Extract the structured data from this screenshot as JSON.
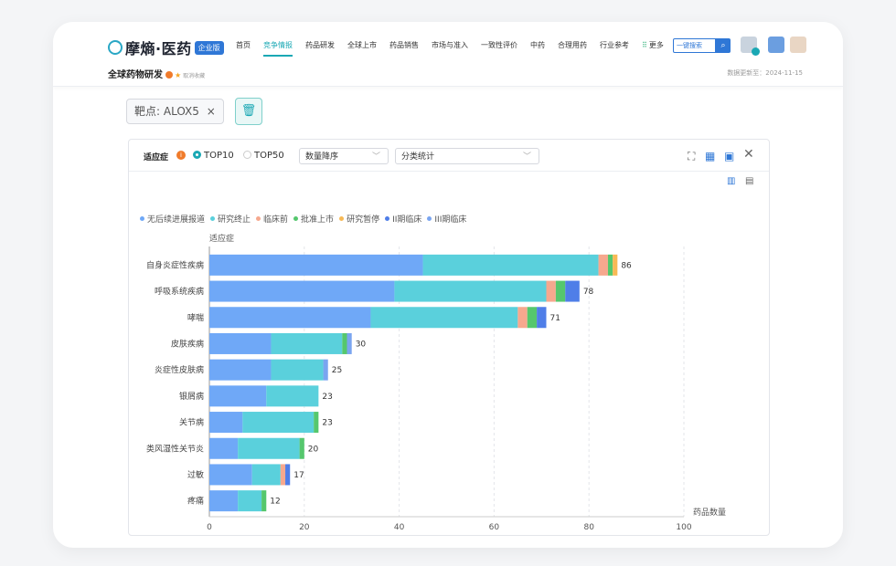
{
  "header": {
    "logo_text": "摩熵·医药",
    "logo_badge": "企业版",
    "nav": [
      "首页",
      "竞争情报",
      "药品研发",
      "全球上市",
      "药品销售",
      "市场与准入",
      "一致性评价",
      "中药",
      "合理用药",
      "行业参考",
      "更多"
    ],
    "nav_active_index": 1,
    "search_label": "一键搜索",
    "page_title": "全球药物研发",
    "favorite_label": "取消收藏",
    "update_text": "数据更新至：2024-11-15"
  },
  "filter": {
    "target_tag": "靶点: ALOX5",
    "tag_close": "×"
  },
  "panel": {
    "title": "适应症",
    "radio_top10": "TOP10",
    "radio_top50": "TOP50",
    "sort_select": "数量降序",
    "stat_select": "分类统计"
  },
  "colors": {
    "accent": "#1aa8b4",
    "primary": "#2f77d6"
  },
  "chart_data": {
    "type": "bar",
    "orientation": "horizontal",
    "stacked": true,
    "ylabel": "适应症",
    "xlabel": "药品数量",
    "xlim": [
      0,
      100
    ],
    "xticks": [
      0,
      20,
      40,
      60,
      80,
      100
    ],
    "categories": [
      "自身炎症性疾病",
      "呼吸系统疾病",
      "哮喘",
      "皮肤疾病",
      "炎症性皮肤病",
      "银屑病",
      "关节病",
      "类风湿性关节炎",
      "过敏",
      "疼痛"
    ],
    "totals": [
      86,
      78,
      71,
      30,
      25,
      23,
      23,
      20,
      17,
      12
    ],
    "series": [
      {
        "name": "无后续进展报道",
        "color": "#6fa8f7",
        "values": [
          45,
          39,
          34,
          13,
          13,
          12,
          7,
          6,
          9,
          6
        ]
      },
      {
        "name": "研究终止",
        "color": "#5ad0dc",
        "values": [
          37,
          32,
          31,
          15,
          11,
          11,
          15,
          13,
          6,
          5
        ]
      },
      {
        "name": "临床前",
        "color": "#f6a88e",
        "values": [
          2,
          2,
          2,
          0,
          0,
          0,
          0,
          0,
          1,
          0
        ]
      },
      {
        "name": "批准上市",
        "color": "#55c76d",
        "values": [
          1,
          2,
          2,
          1,
          0,
          0,
          1,
          1,
          0,
          1
        ]
      },
      {
        "name": "研究暂停",
        "color": "#f7b955",
        "values": [
          1,
          0,
          0,
          0,
          0,
          0,
          0,
          0,
          0,
          0
        ]
      },
      {
        "name": "II期临床",
        "color": "#4f7ee8",
        "values": [
          0,
          3,
          2,
          0,
          0,
          0,
          0,
          0,
          1,
          0
        ]
      },
      {
        "name": "III期临床",
        "color": "#7aa5f0",
        "values": [
          0,
          0,
          0,
          1,
          1,
          0,
          0,
          0,
          0,
          0
        ]
      }
    ],
    "grid": true,
    "legend_position": "top-left"
  }
}
